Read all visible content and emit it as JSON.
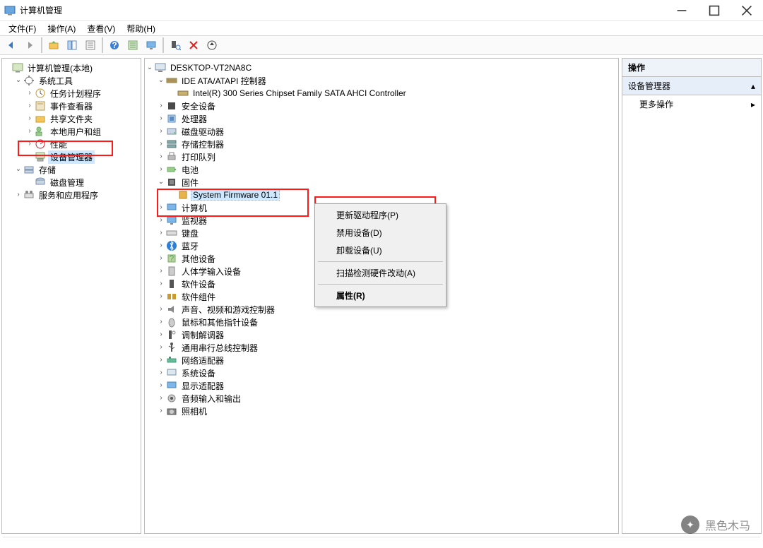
{
  "window": {
    "title": "计算机管理"
  },
  "menu": {
    "file": "文件(F)",
    "action": "操作(A)",
    "view": "查看(V)",
    "help": "帮助(H)"
  },
  "left_tree": {
    "root": "计算机管理(本地)",
    "n1": "系统工具",
    "n1a": "任务计划程序",
    "n1b": "事件查看器",
    "n1c": "共享文件夹",
    "n1d": "本地用户和组",
    "n1e": "性能",
    "n1f": "设备管理器",
    "n2": "存储",
    "n2a": "磁盘管理",
    "n3": "服务和应用程序"
  },
  "center": {
    "root": "DESKTOP-VT2NA8C",
    "c0": "IDE ATA/ATAPI 控制器",
    "c0a": "Intel(R) 300 Series Chipset Family SATA AHCI Controller",
    "c1": "安全设备",
    "c2": "处理器",
    "c3": "磁盘驱动器",
    "c4": "存储控制器",
    "c5": "打印队列",
    "c6": "电池",
    "c7": "固件",
    "c7a": "System Firmware 01.1",
    "c8": "计算机",
    "c9": "监视器",
    "c10": "键盘",
    "c11": "蓝牙",
    "c12": "其他设备",
    "c13": "人体学输入设备",
    "c14": "软件设备",
    "c15": "软件组件",
    "c16": "声音、视频和游戏控制器",
    "c17": "鼠标和其他指针设备",
    "c18": "调制解调器",
    "c19": "通用串行总线控制器",
    "c20": "网络适配器",
    "c21": "系统设备",
    "c22": "显示适配器",
    "c23": "音频输入和输出",
    "c24": "照相机"
  },
  "ctx": {
    "m1": "更新驱动程序(P)",
    "m2": "禁用设备(D)",
    "m3": "卸载设备(U)",
    "m4": "扫描检测硬件改动(A)",
    "m5": "属性(R)"
  },
  "right": {
    "hdr": "操作",
    "section": "设备管理器",
    "more": "更多操作"
  },
  "watermark": "黑色木马"
}
